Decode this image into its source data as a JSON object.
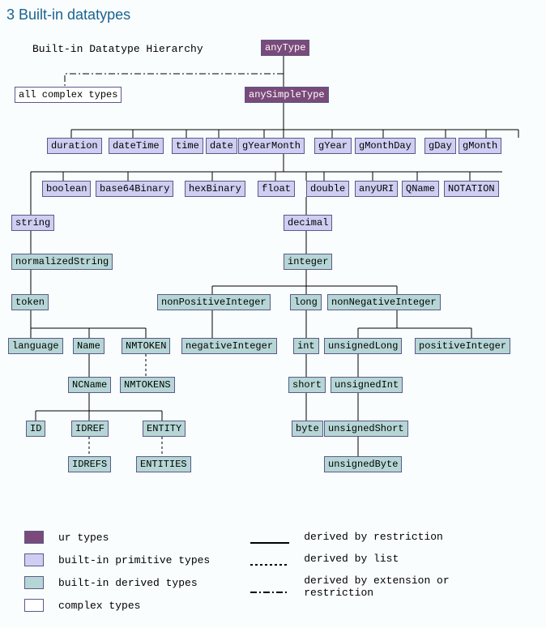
{
  "heading": "3 Built-in datatypes",
  "subtitle": "Built-in Datatype Hierarchy",
  "nodes": {
    "anyType": "anyType",
    "anySimpleType": "anySimpleType",
    "allComplex": "all complex types",
    "duration": "duration",
    "dateTime": "dateTime",
    "time": "time",
    "date": "date",
    "gYearMonth": "gYearMonth",
    "gYear": "gYear",
    "gMonthDay": "gMonthDay",
    "gDay": "gDay",
    "gMonth": "gMonth",
    "boolean": "boolean",
    "base64Binary": "base64Binary",
    "hexBinary": "hexBinary",
    "float": "float",
    "double": "double",
    "anyURI": "anyURI",
    "QName": "QName",
    "NOTATION": "NOTATION",
    "string": "string",
    "decimal": "decimal",
    "normalizedString": "normalizedString",
    "integer": "integer",
    "token": "token",
    "nonPositiveInteger": "nonPositiveInteger",
    "long": "long",
    "nonNegativeInteger": "nonNegativeInteger",
    "language": "language",
    "Name": "Name",
    "NMTOKEN": "NMTOKEN",
    "negativeInteger": "negativeInteger",
    "int": "int",
    "unsignedLong": "unsignedLong",
    "positiveInteger": "positiveInteger",
    "NCName": "NCName",
    "NMTOKENS": "NMTOKENS",
    "short": "short",
    "unsignedInt": "unsignedInt",
    "ID": "ID",
    "IDREF": "IDREF",
    "ENTITY": "ENTITY",
    "byte": "byte",
    "unsignedShort": "unsignedShort",
    "IDREFS": "IDREFS",
    "ENTITIES": "ENTITIES",
    "unsignedByte": "unsignedByte"
  },
  "legend": {
    "ur": "ur types",
    "prim": "built-in primitive types",
    "der": "built-in derived types",
    "complex": "complex types",
    "restrict": "derived by restriction",
    "list": "derived by list",
    "ext": "derived by extension or restriction"
  }
}
